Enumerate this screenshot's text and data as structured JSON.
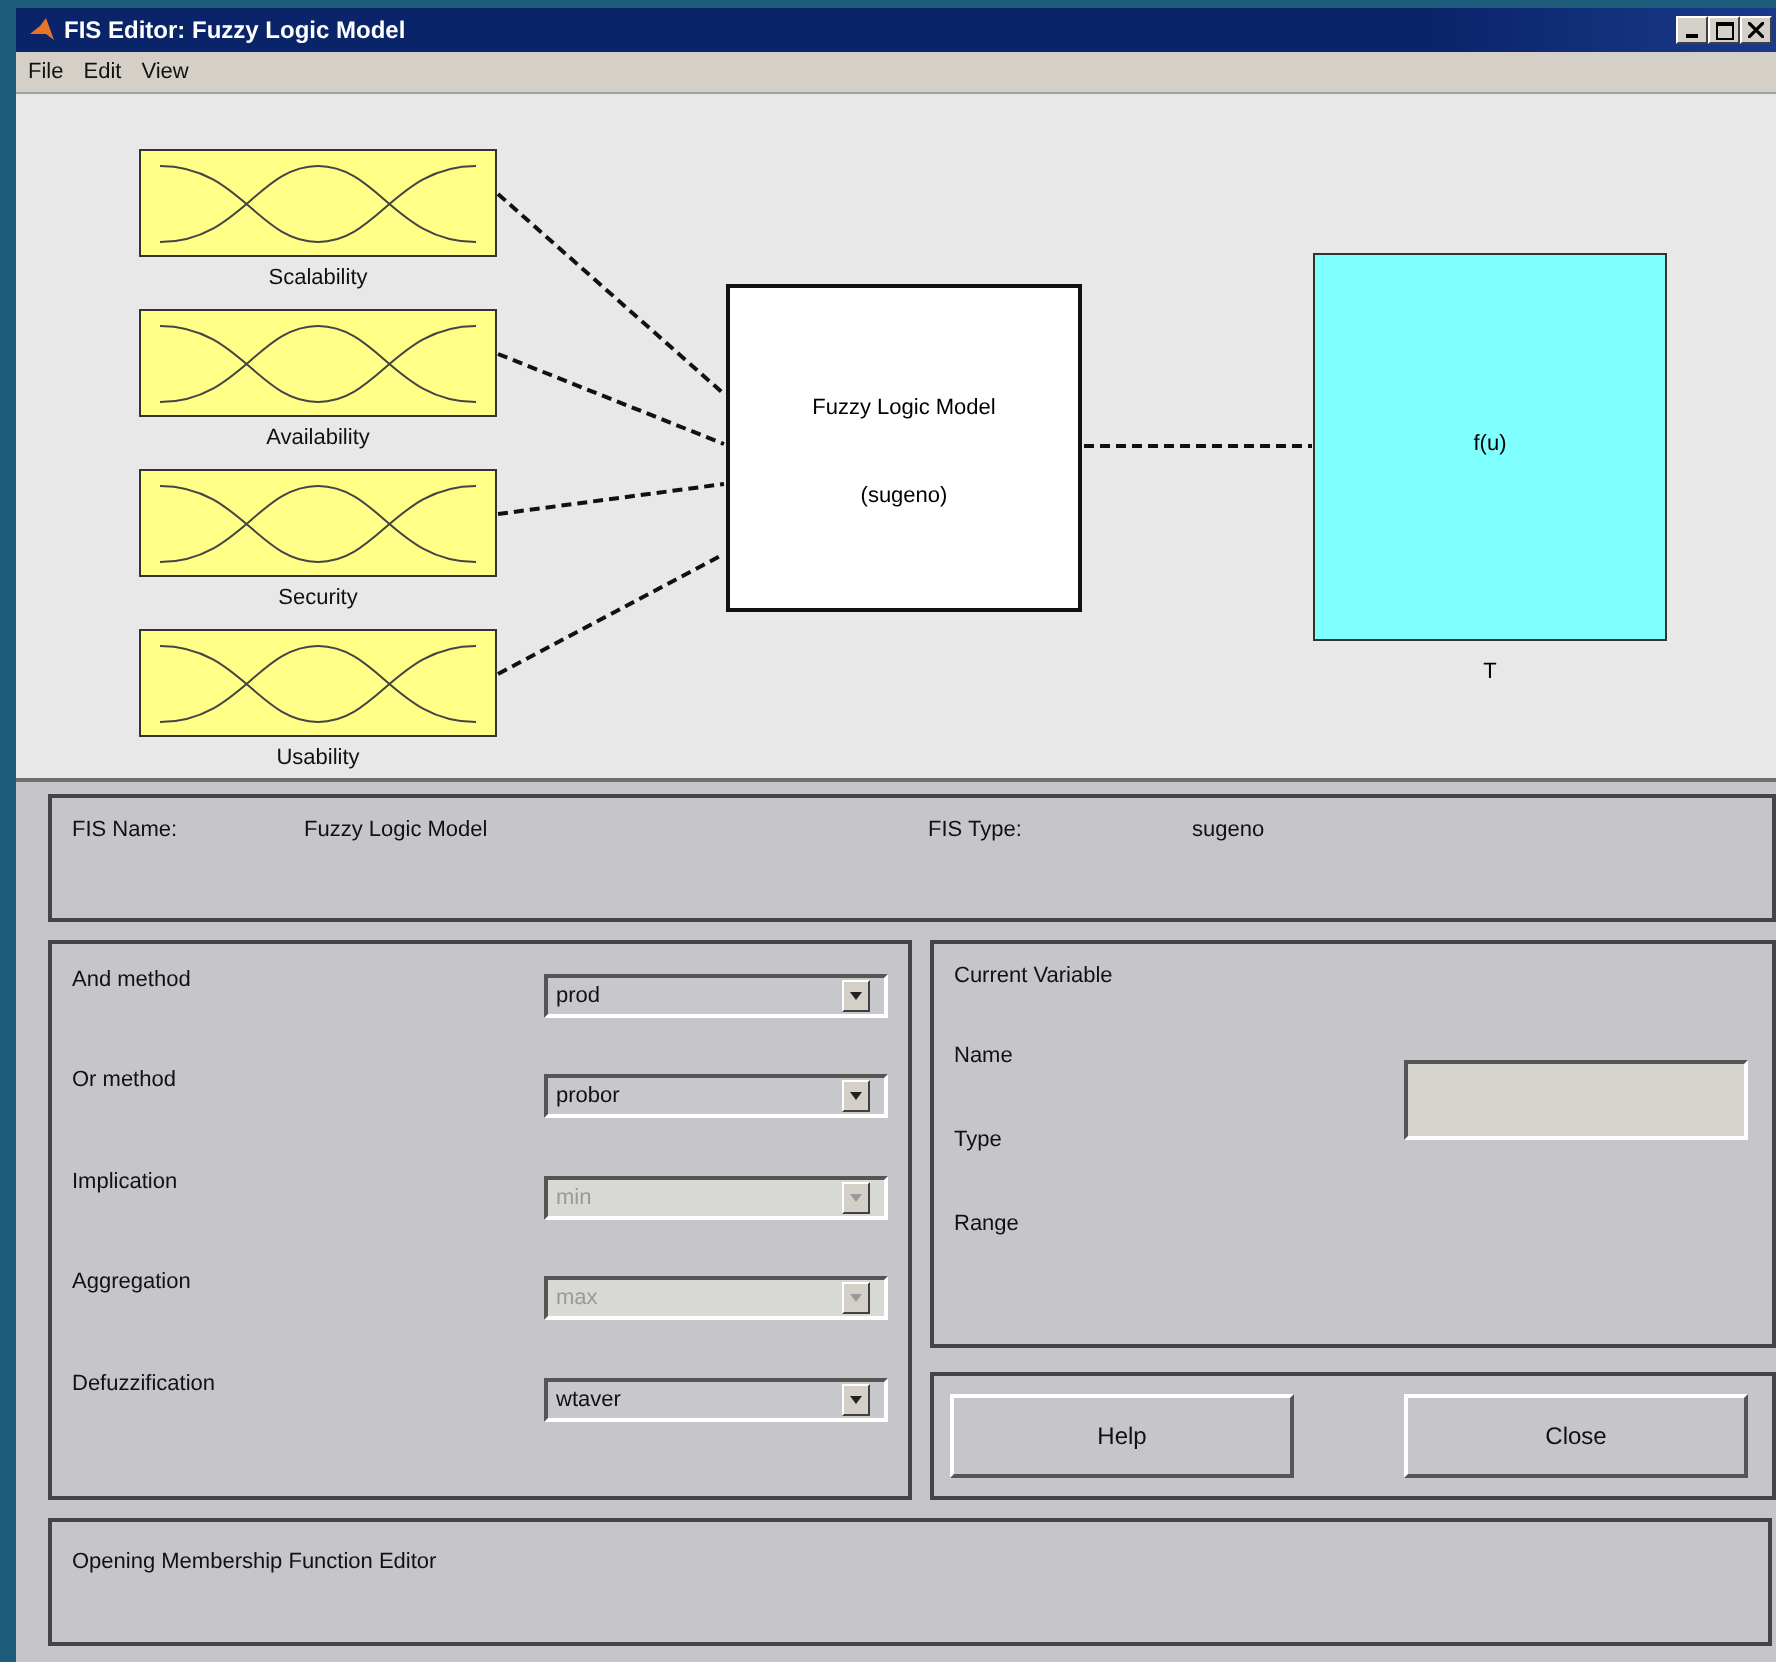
{
  "window": {
    "title": "FIS Editor: Fuzzy Logic Model"
  },
  "menu": [
    "File",
    "Edit",
    "View"
  ],
  "diagram": {
    "inputs": [
      {
        "label": "Scalability"
      },
      {
        "label": "Availability"
      },
      {
        "label": "Security"
      },
      {
        "label": "Usability"
      }
    ],
    "system": {
      "name": "Fuzzy Logic Model",
      "type": "(sugeno)"
    },
    "output": {
      "function": "f(u)",
      "label": "T"
    }
  },
  "fis": {
    "name_label": "FIS Name:",
    "name": "Fuzzy Logic Model",
    "type_label": "FIS Type:",
    "type": "sugeno"
  },
  "methods": [
    {
      "label": "And method",
      "value": "prod",
      "disabled": false
    },
    {
      "label": "Or method",
      "value": "probor",
      "disabled": false
    },
    {
      "label": "Implication",
      "value": "min",
      "disabled": true
    },
    {
      "label": "Aggregation",
      "value": "max",
      "disabled": true
    },
    {
      "label": "Defuzzification",
      "value": "wtaver",
      "disabled": false
    }
  ],
  "current_variable": {
    "title": "Current Variable",
    "fields": [
      "Name",
      "Type",
      "Range"
    ]
  },
  "buttons": [
    "Help",
    "Close"
  ],
  "status": "Opening Membership Function Editor"
}
